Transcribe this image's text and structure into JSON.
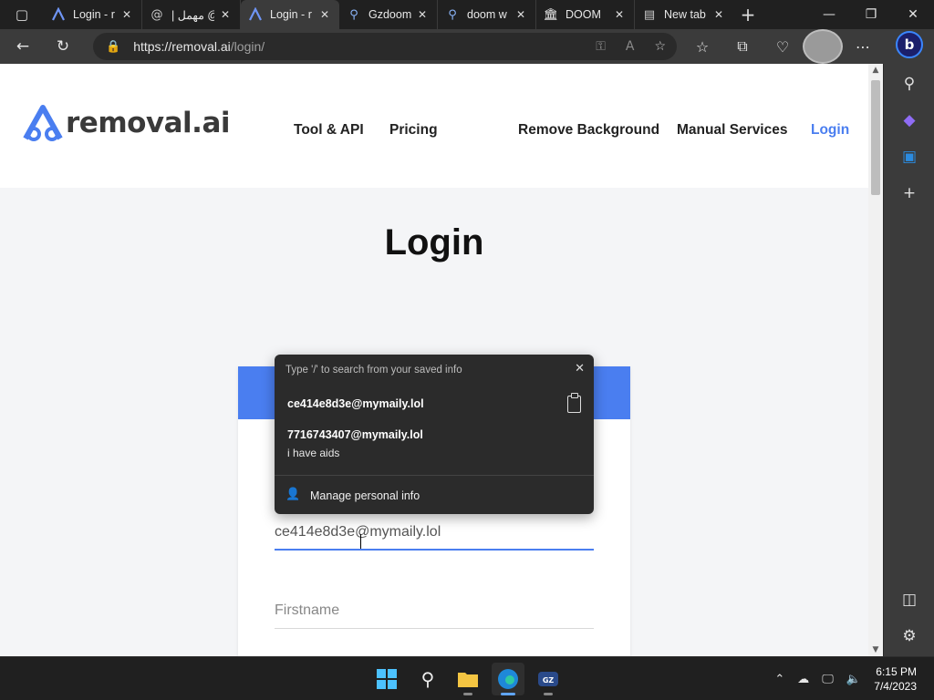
{
  "browser": {
    "tabs": [
      {
        "title": "Login - r",
        "icon": "removal-logo-icon",
        "active": false
      },
      {
        "title": "| مهمل @",
        "icon": "at-icon",
        "active": false
      },
      {
        "title": "Login - r",
        "icon": "removal-logo-icon",
        "active": true
      },
      {
        "title": "Gzdoom",
        "icon": "search-icon",
        "active": false
      },
      {
        "title": "doom w",
        "icon": "search-icon",
        "active": false
      },
      {
        "title": "DOOM",
        "icon": "museum-icon",
        "active": false
      },
      {
        "title": "New tab",
        "icon": "newtab-icon",
        "active": false
      }
    ],
    "url_host": "https://removal.ai",
    "url_path": "/login/"
  },
  "site": {
    "logo_text": "removal.ai",
    "nav": {
      "tool_api": "Tool & API",
      "pricing": "Pricing",
      "remove_bg": "Remove Background",
      "manual": "Manual Services",
      "login": "Login"
    },
    "login_title": "Login",
    "accent_color": "#4a7ef0"
  },
  "form": {
    "email_value": "ce414e8d3e@mymaily.lol",
    "firstname_placeholder": "Firstname"
  },
  "autofill": {
    "hint": "Type '/' to search from your saved info",
    "suggestion_1": "ce414e8d3e@mymaily.lol",
    "suggestion_2": "7716743407@mymaily.lol",
    "suggestion_2_sub": "i have aids",
    "manage": "Manage personal info"
  },
  "taskbar": {
    "time": "6:15 PM",
    "date": "7/4/2023"
  }
}
